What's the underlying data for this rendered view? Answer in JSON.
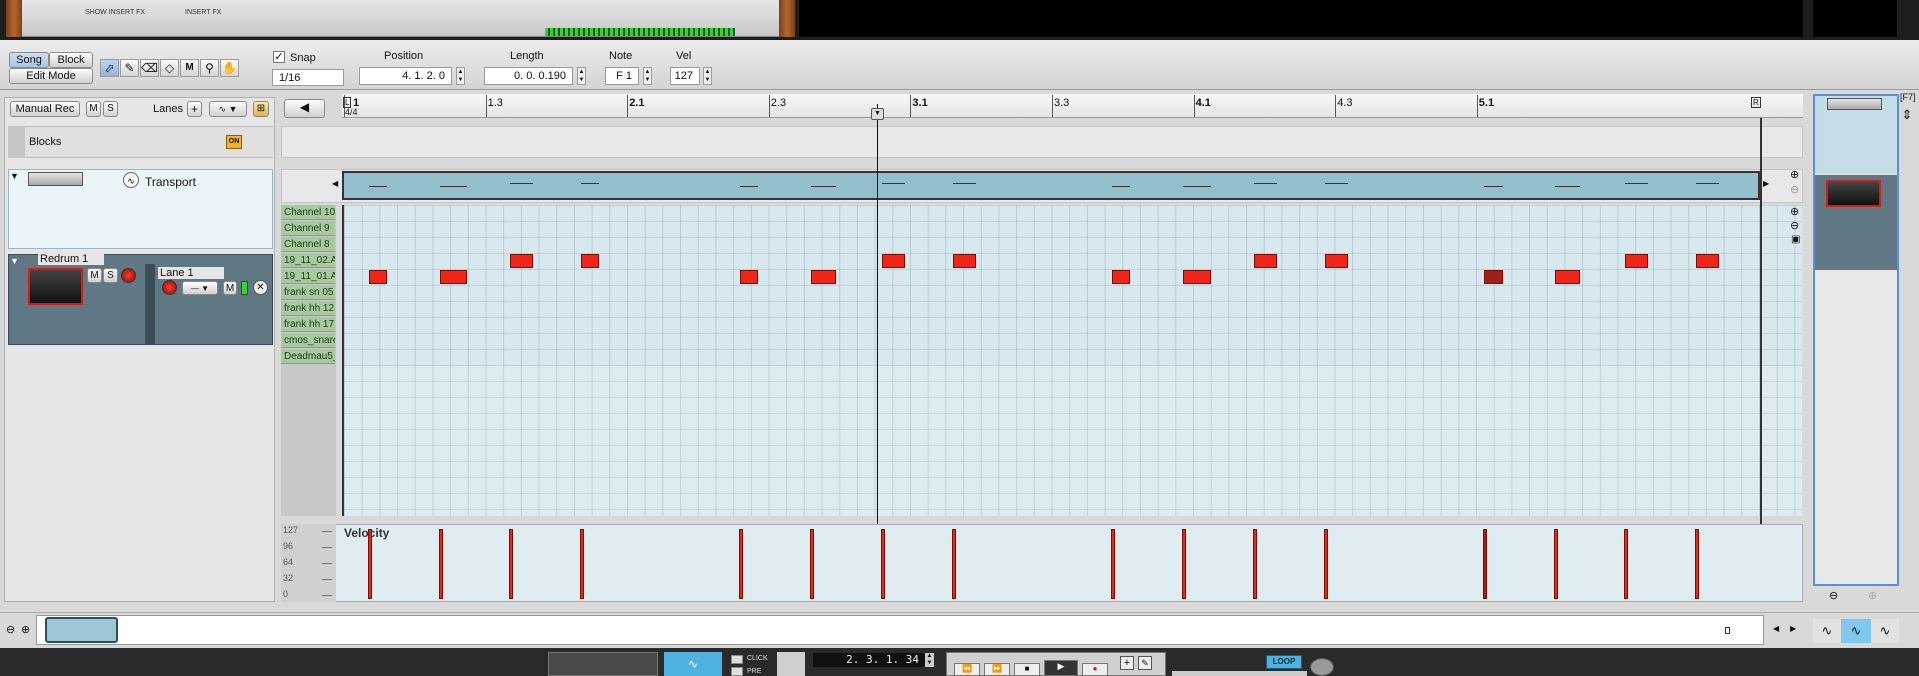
{
  "mode": {
    "song": "Song",
    "block": "Block",
    "edit_mode": "Edit Mode"
  },
  "top_rack": {
    "show_insert_fx": "SHOW INSERT FX",
    "insert_fx": "INSERT FX"
  },
  "toolbar": {
    "snap_label": "Snap",
    "snap_value": "1/16",
    "position_label": "Position",
    "position_value": "4.  1.  2.    0",
    "length_label": "Length",
    "length_value": "0.  0.  0.190",
    "note_label": "Note",
    "note_value": "F 1",
    "vel_label": "Vel",
    "vel_value": "127",
    "f7": "[F7]"
  },
  "left_panel": {
    "manual_rec": "Manual Rec",
    "mute": "M",
    "solo": "S",
    "lanes": "Lanes",
    "blocks": "Blocks",
    "blocks_on": "ON",
    "transport": "Transport",
    "track_name": "Redrum 1",
    "lane_name": "Lane 1"
  },
  "ruler": {
    "bars": [
      {
        "label": "1",
        "major": true
      },
      {
        "label": "1.3",
        "major": false
      },
      {
        "label": "2.1",
        "major": true
      },
      {
        "label": "2.3",
        "major": false
      },
      {
        "label": "3.1",
        "major": true
      },
      {
        "label": "3.3",
        "major": false
      },
      {
        "label": "4.1",
        "major": true
      },
      {
        "label": "4.3",
        "major": false
      },
      {
        "label": "5.1",
        "major": true
      }
    ],
    "time_signature": "4/4",
    "left_marker": "L",
    "right_marker": "R"
  },
  "channels": [
    "Channel 10",
    "Channel 9",
    "Channel 8",
    "19_11_02.A",
    "19_11_01.A",
    "frank sn 05",
    "frank hh 12",
    "frank hh 17",
    "cmos_snare",
    "Deadmau5_"
  ],
  "velocity_lane": {
    "title": "Velocity",
    "scale": [
      "127",
      "96",
      "64",
      "32",
      "0"
    ]
  },
  "notes": [
    {
      "step": 1,
      "row": 4,
      "len": 1,
      "vel": 127
    },
    {
      "step": 5,
      "row": 4,
      "len": 1.5,
      "vel": 127
    },
    {
      "step": 9,
      "row": 3,
      "len": 1.3,
      "vel": 127
    },
    {
      "step": 13,
      "row": 3,
      "len": 1,
      "vel": 127
    },
    {
      "step": 22,
      "row": 4,
      "len": 1,
      "vel": 127
    },
    {
      "step": 26,
      "row": 4,
      "len": 1.4,
      "vel": 127
    },
    {
      "step": 30,
      "row": 3,
      "len": 1.3,
      "vel": 127
    },
    {
      "step": 34,
      "row": 3,
      "len": 1.3,
      "vel": 127
    },
    {
      "step": 43,
      "row": 4,
      "len": 1,
      "vel": 127
    },
    {
      "step": 47,
      "row": 4,
      "len": 1.6,
      "vel": 127
    },
    {
      "step": 51,
      "row": 3,
      "len": 1.3,
      "vel": 127
    },
    {
      "step": 55,
      "row": 3,
      "len": 1.3,
      "vel": 127
    },
    {
      "step": 64,
      "row": 4,
      "len": 1.1,
      "vel": 127,
      "selected": true
    },
    {
      "step": 68,
      "row": 4,
      "len": 1.4,
      "vel": 127
    },
    {
      "step": 72,
      "row": 3,
      "len": 1.3,
      "vel": 127
    },
    {
      "step": 76,
      "row": 3,
      "len": 1.3,
      "vel": 127
    }
  ],
  "transport_bar": {
    "position": "2.  3.  1.  34",
    "click": "CLICK",
    "pre": "PRE",
    "loop": "LOOP"
  },
  "colors": {
    "note": "#f02518",
    "note_selected": "#a02015",
    "grid_bg": "#d7e9ee",
    "block_strip": "#93bfcc",
    "channel_label": "#a6c99e"
  }
}
